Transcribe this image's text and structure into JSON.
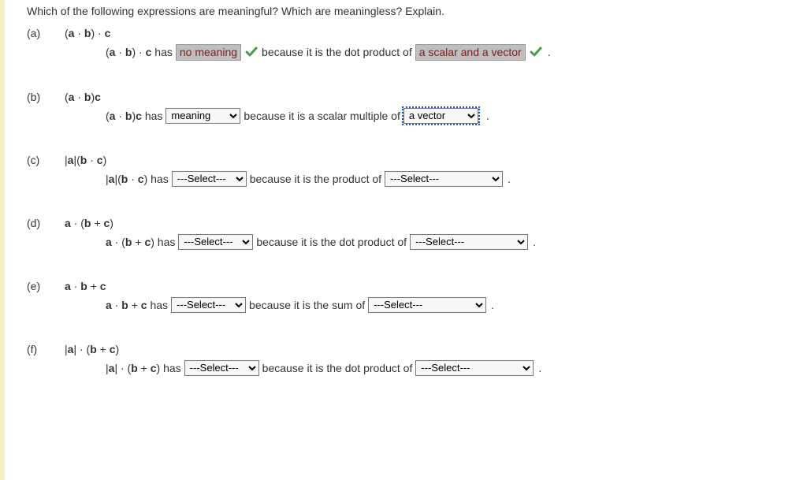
{
  "prompt": "Which of the following expressions are meaningful? Which are meaningless? Explain.",
  "select_placeholder": "---Select---",
  "has_text": " has ",
  "period": ".",
  "parts": {
    "a": {
      "label": "(a)",
      "expr_prefix": "(",
      "expr_a": "a",
      "expr_dot1": " · ",
      "expr_b": "b",
      "expr_mid": ") · ",
      "expr_c": "c",
      "ans_expr_prefix": "(",
      "ans_a": "a",
      "ans_dot1": " · ",
      "ans_b": "b",
      "ans_mid": ") · ",
      "ans_c": "c",
      "selected1": "no meaning",
      "between": " because it is the dot product of ",
      "selected2": "a scalar and a vector"
    },
    "b": {
      "label": "(b)",
      "expr_prefix": "(",
      "expr_a": "a",
      "expr_dot1": " · ",
      "expr_b": "b",
      "expr_suffix": ")",
      "expr_c": "c",
      "ans_expr_prefix": "(",
      "ans_a": "a",
      "ans_dot1": " · ",
      "ans_b": "b",
      "ans_suffix": ")",
      "ans_c": "c",
      "selected1": "meaning",
      "between": " because it is a scalar multiple of ",
      "selected2": "a vector"
    },
    "c": {
      "label": "(c)",
      "bar_a": "a",
      "bar_open": "|",
      "bar_close": "|",
      "expr_prefix": "(",
      "expr_b": "b",
      "expr_dot1": " · ",
      "expr_c": "c",
      "expr_suffix": ")",
      "between": " because it is the product of "
    },
    "d": {
      "label": "(d)",
      "expr_a": "a",
      "expr_dot1": " · (",
      "expr_b": "b",
      "expr_plus": " + ",
      "expr_c": "c",
      "expr_suffix": ")",
      "between": " because it is the dot product of "
    },
    "e": {
      "label": "(e)",
      "expr_a": "a",
      "expr_dot1": " · ",
      "expr_b": "b",
      "expr_plus": " + ",
      "expr_c": "c",
      "between": " because it is the sum of "
    },
    "f": {
      "label": "(f)",
      "bar_open": "|",
      "bar_a": "a",
      "bar_close": "|",
      "expr_dot1": " · (",
      "expr_b": "b",
      "expr_plus": " + ",
      "expr_c": "c",
      "expr_suffix": ")",
      "between": " because it is the dot product of "
    }
  }
}
